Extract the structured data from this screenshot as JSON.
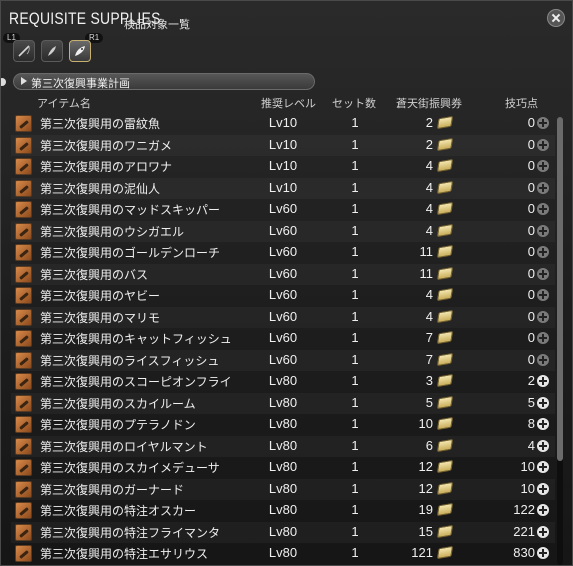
{
  "window": {
    "title": "REQUISITE SUPPLIES",
    "subtitle": "検品対象一覧"
  },
  "shoulders": {
    "left": "L1",
    "right": "R1"
  },
  "categories": [
    {
      "icon": "fishing-rod-icon",
      "active": false
    },
    {
      "icon": "fish-icon",
      "active": false
    },
    {
      "icon": "fish-selected-icon",
      "active": true
    }
  ],
  "group": {
    "label": "第三次復興事業計画"
  },
  "columns": {
    "item": "アイテム名",
    "level": "推奨レベル",
    "set": "セット数",
    "scrip": "蒼天街振興券",
    "points": "技巧点"
  },
  "rows": [
    {
      "name": "第三次復興用の雷紋魚",
      "level": "Lv10",
      "set": "1",
      "scrip": "2",
      "points": "0",
      "plus": "dim"
    },
    {
      "name": "第三次復興用のワニガメ",
      "level": "Lv10",
      "set": "1",
      "scrip": "2",
      "points": "0",
      "plus": "dim"
    },
    {
      "name": "第三次復興用のアロワナ",
      "level": "Lv10",
      "set": "1",
      "scrip": "4",
      "points": "0",
      "plus": "dim"
    },
    {
      "name": "第三次復興用の泥仙人",
      "level": "Lv10",
      "set": "1",
      "scrip": "4",
      "points": "0",
      "plus": "dim"
    },
    {
      "name": "第三次復興用のマッドスキッパー",
      "level": "Lv60",
      "set": "1",
      "scrip": "4",
      "points": "0",
      "plus": "dim"
    },
    {
      "name": "第三次復興用のウシガエル",
      "level": "Lv60",
      "set": "1",
      "scrip": "4",
      "points": "0",
      "plus": "dim"
    },
    {
      "name": "第三次復興用のゴールデンローチ",
      "level": "Lv60",
      "set": "1",
      "scrip": "11",
      "points": "0",
      "plus": "dim"
    },
    {
      "name": "第三次復興用のバス",
      "level": "Lv60",
      "set": "1",
      "scrip": "11",
      "points": "0",
      "plus": "dim"
    },
    {
      "name": "第三次復興用のヤビー",
      "level": "Lv60",
      "set": "1",
      "scrip": "4",
      "points": "0",
      "plus": "dim"
    },
    {
      "name": "第三次復興用のマリモ",
      "level": "Lv60",
      "set": "1",
      "scrip": "4",
      "points": "0",
      "plus": "dim"
    },
    {
      "name": "第三次復興用のキャットフィッシュ",
      "level": "Lv60",
      "set": "1",
      "scrip": "7",
      "points": "0",
      "plus": "dim"
    },
    {
      "name": "第三次復興用のライスフィッシュ",
      "level": "Lv60",
      "set": "1",
      "scrip": "7",
      "points": "0",
      "plus": "dim"
    },
    {
      "name": "第三次復興用のスコーピオンフライ",
      "level": "Lv80",
      "set": "1",
      "scrip": "3",
      "points": "2",
      "plus": "bright"
    },
    {
      "name": "第三次復興用のスカイルーム",
      "level": "Lv80",
      "set": "1",
      "scrip": "5",
      "points": "5",
      "plus": "bright"
    },
    {
      "name": "第三次復興用のプテラノドン",
      "level": "Lv80",
      "set": "1",
      "scrip": "10",
      "points": "8",
      "plus": "bright"
    },
    {
      "name": "第三次復興用のロイヤルマント",
      "level": "Lv80",
      "set": "1",
      "scrip": "6",
      "points": "4",
      "plus": "bright"
    },
    {
      "name": "第三次復興用のスカイメデューサ",
      "level": "Lv80",
      "set": "1",
      "scrip": "12",
      "points": "10",
      "plus": "bright"
    },
    {
      "name": "第三次復興用のガーナード",
      "level": "Lv80",
      "set": "1",
      "scrip": "12",
      "points": "10",
      "plus": "bright"
    },
    {
      "name": "第三次復興用の特注オスカー",
      "level": "Lv80",
      "set": "1",
      "scrip": "19",
      "points": "122",
      "plus": "bright"
    },
    {
      "name": "第三次復興用の特注フライマンタ",
      "level": "Lv80",
      "set": "1",
      "scrip": "15",
      "points": "221",
      "plus": "bright"
    },
    {
      "name": "第三次復興用の特注エサリウス",
      "level": "Lv80",
      "set": "1",
      "scrip": "121",
      "points": "830",
      "plus": "bright"
    }
  ]
}
